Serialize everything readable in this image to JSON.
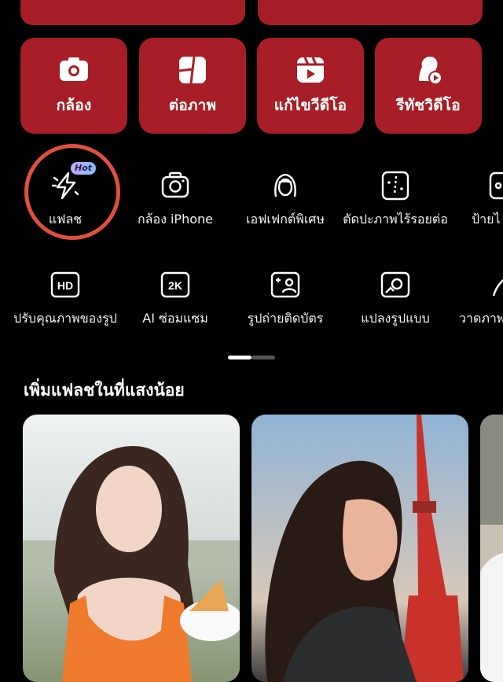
{
  "tool_cards": [
    {
      "label": "กล้อง",
      "icon": "camera-icon"
    },
    {
      "label": "ต่อภาพ",
      "icon": "collage-icon"
    },
    {
      "label": "แก้ไขวีดีโอ",
      "icon": "video-edit-icon"
    },
    {
      "label": "รีทัชวิดีโอ",
      "icon": "video-retouch-icon"
    }
  ],
  "features_row1": [
    {
      "label": "แฟลช",
      "icon": "flash-icon",
      "badge": "Hot"
    },
    {
      "label": "กล้อง iPhone",
      "icon": "iphone-camera-icon"
    },
    {
      "label": "เอฟเฟกต์พิเศษ",
      "icon": "face-effect-icon"
    },
    {
      "label": "ตัดปะภาพไร้รอยต่อ",
      "icon": "seamless-cut-icon"
    },
    {
      "label": "ป้ายไ",
      "icon": "tag-icon"
    }
  ],
  "features_row2": [
    {
      "label": "ปรับคุณภาพของรูป",
      "icon": "hd-icon"
    },
    {
      "label": "AI ซ่อมแซม",
      "icon": "2k-icon"
    },
    {
      "label": "รูปถ่ายติดบัตร",
      "icon": "id-photo-icon"
    },
    {
      "label": "แปลงรูปแบบ",
      "icon": "style-transform-icon"
    },
    {
      "label": "วาดภาพ",
      "icon": "draw-icon"
    }
  ],
  "section": {
    "title": "เพิ่มแฟลชในที่แสงน้อย"
  },
  "colors": {
    "card_red": "#a81e26",
    "highlight": "#e0503e"
  }
}
